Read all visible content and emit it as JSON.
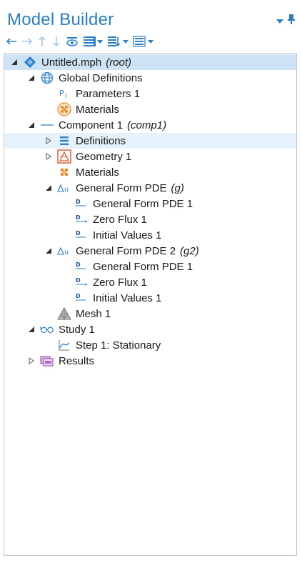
{
  "panel": {
    "title": "Model Builder"
  },
  "toolbar": {
    "buttons": [
      {
        "name": "back-arrow-icon"
      },
      {
        "name": "forward-arrow-icon"
      },
      {
        "name": "move-up-icon"
      },
      {
        "name": "move-down-icon"
      },
      {
        "name": "show-icon"
      },
      {
        "name": "expand-sections-icon"
      },
      {
        "name": "sort-icon"
      },
      {
        "name": "view-options-icon"
      }
    ]
  },
  "tree": {
    "root": {
      "label": "Untitled.mph",
      "tag": "(root)"
    },
    "global": {
      "label": "Global Definitions"
    },
    "parameters": {
      "label": "Parameters 1"
    },
    "global_materials": {
      "label": "Materials"
    },
    "component": {
      "label": "Component 1",
      "tag": "(comp1)"
    },
    "definitions": {
      "label": "Definitions"
    },
    "geometry": {
      "label": "Geometry 1"
    },
    "comp_materials": {
      "label": "Materials"
    },
    "pde_g": {
      "label": "General Form PDE",
      "tag": "(g)"
    },
    "pde_g_children": [
      "General Form PDE 1",
      "Zero Flux 1",
      "Initial Values 1"
    ],
    "pde_g2": {
      "label": "General Form PDE 2",
      "tag": "(g2)"
    },
    "pde_g2_children": [
      "General Form PDE 1",
      "Zero Flux 1",
      "Initial Values 1"
    ],
    "mesh": {
      "label": "Mesh 1"
    },
    "study": {
      "label": "Study 1"
    },
    "step": {
      "label": "Step 1: Stationary"
    },
    "results": {
      "label": "Results"
    }
  },
  "colors": {
    "accent": "#2a7fc6",
    "selection": "#cfe3f6",
    "hover": "#e5f1fb"
  }
}
